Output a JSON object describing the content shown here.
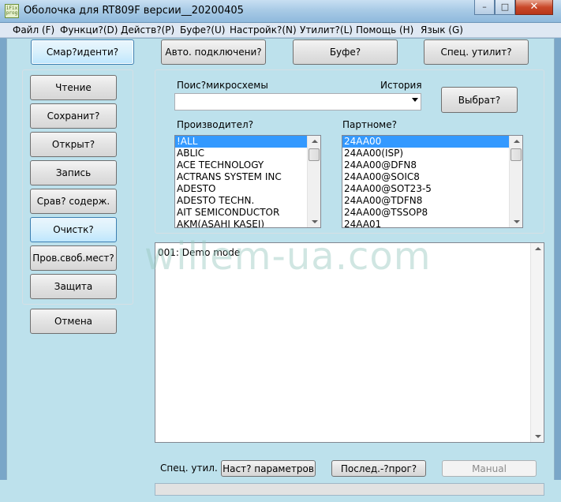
{
  "window": {
    "title": "Оболочка для RT809F версии__20200405",
    "icon_text": "iFix prog",
    "controls": {
      "minimize": "–",
      "maximize": "□",
      "close": "✕"
    }
  },
  "menu": [
    "Файл (F)",
    "Функци?(D)",
    "Действ?(P)",
    "Буфе?(U)",
    "Настройк?(N)",
    "Утилит?(L)",
    "Помощь (H)",
    "Язык (G)"
  ],
  "toolbar": {
    "smart_ident": "Смар?иденти?",
    "auto_connect": "Авто. подключени?",
    "buffer": "Буфе?",
    "special_utils": "Спец. утилит?"
  },
  "sidebar": {
    "read": "Чтение",
    "save": "Сохранит?",
    "open": "Открыт?",
    "write": "Запись",
    "compare": "Срав? содерж.",
    "erase": "Очистк?",
    "blank_check": "Пров.своб.мест?",
    "protect": "Защита",
    "cancel": "Отмена"
  },
  "search": {
    "label": "Поис?микросхемы",
    "history_label": "История",
    "value": "",
    "select_button": "Выбрат?"
  },
  "manufacturers": {
    "label": "Производител?",
    "items": [
      "!ALL",
      "ABLIC",
      "ACE TECHNOLOGY",
      "ACTRANS SYSTEM INC",
      "ADESTO",
      "ADESTO TECHN.",
      "AIT SEMICONDUCTOR",
      "AKM(ASAHI KASEI)"
    ],
    "selected": "!ALL"
  },
  "part_numbers": {
    "label": "Партноме?",
    "items": [
      "24AA00",
      "24AA00(ISP)",
      "24AA00@DFN8",
      "24AA00@SOIC8",
      "24AA00@SOT23-5",
      "24AA00@TDFN8",
      "24AA00@TSSOP8",
      "24AA01"
    ],
    "selected": "24AA00"
  },
  "log": {
    "lines": [
      "001:  Demo mode"
    ],
    "watermark": "willem-ua.com"
  },
  "bottom": {
    "label": "Спец. утил.",
    "params_button": "Наст? параметров",
    "sequence_button": "Послед.-?прог?",
    "manual_button": "Манual"
  },
  "colors": {
    "client_bg": "#bde1ec",
    "selection": "#3399ff",
    "active_button": "#bee6fd"
  }
}
